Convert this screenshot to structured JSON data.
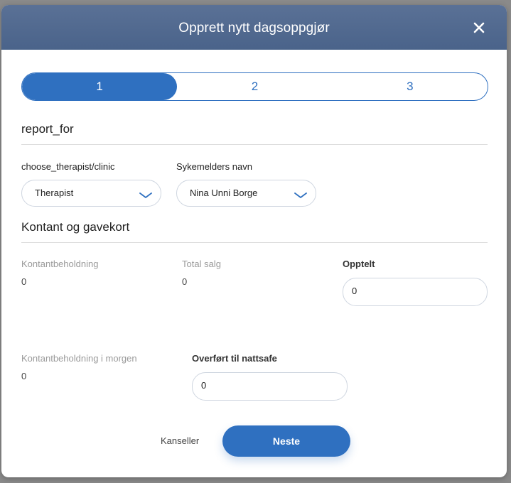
{
  "modal": {
    "title": "Opprett nytt dagsoppgjør",
    "close_icon": "close-icon"
  },
  "stepper": {
    "steps": [
      {
        "label": "1",
        "active": true
      },
      {
        "label": "2",
        "active": false
      },
      {
        "label": "3",
        "active": false
      }
    ]
  },
  "report_section": {
    "title": "report_for",
    "therapist_field": {
      "label": "choose_therapist/clinic",
      "value": "Therapist"
    },
    "sick_note_field": {
      "label": "Sykemelders navn",
      "value": "Nina Unni Borge"
    }
  },
  "cash_section": {
    "title": "Kontant og gavekort",
    "cash_holding": {
      "label": "Kontantbeholdning",
      "value": "0"
    },
    "total_sales": {
      "label": "Total salg",
      "value": "0"
    },
    "counted": {
      "label": "Opptelt",
      "value": "0"
    },
    "cash_tomorrow": {
      "label": "Kontantbeholdning i morgen",
      "value": "0"
    },
    "night_safe": {
      "label": "Overført til nattsafe",
      "value": "0"
    }
  },
  "footer": {
    "cancel_label": "Kanseller",
    "next_label": "Neste"
  },
  "colors": {
    "header": "#4f688f",
    "accent": "#2f70c0"
  }
}
